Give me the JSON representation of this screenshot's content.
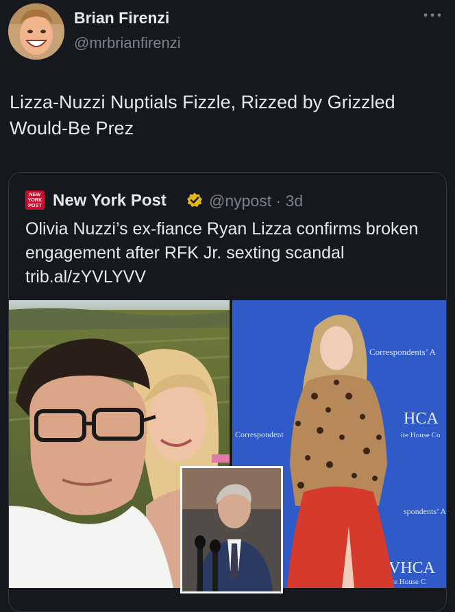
{
  "tweet": {
    "author": {
      "display_name": "Brian Firenzi",
      "handle": "@mrbrianfirenzi",
      "avatar_icon": "profile-photo"
    },
    "more_icon": "ellipsis-icon",
    "text": "Lizza-Nuzzi Nuptials Fizzle, Rizzed by Grizzled Would-Be Prez"
  },
  "quote": {
    "logo_text": "NEW YORK POST",
    "author_name": "New York Post",
    "verified_badge": "gold-check",
    "handle_time": "@nypost · 3d",
    "text": "Olivia Nuzzi’s ex-fiance Ryan Lizza confirms broken engagement after RFK Jr. sexting scandal trib.al/zYVLYVV",
    "backdrop_texts": [
      "Correspondents’ A",
      "Correspondent",
      "HCA",
      "ite House Co",
      "spondents’ A",
      "VHCA",
      "ite House C"
    ]
  },
  "colors": {
    "background": "#15181d",
    "text_primary": "#e7e9ea",
    "text_secondary": "#7b8188",
    "border": "#31363c",
    "nypost_red": "#c8102e",
    "verified_gold": "#e2b719"
  }
}
